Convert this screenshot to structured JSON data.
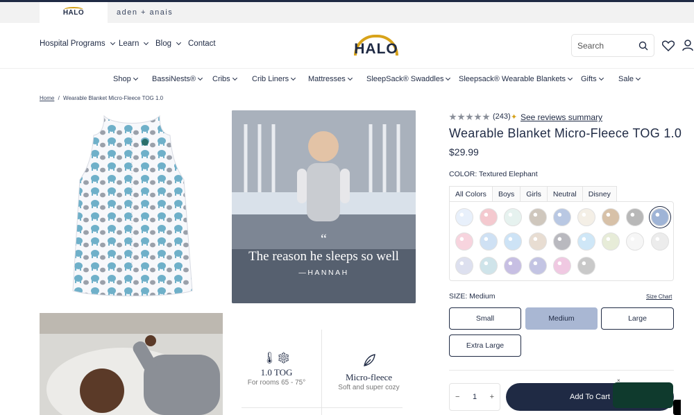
{
  "brand_bar": {
    "halo_tab": "HALO",
    "partner": "aden + anais"
  },
  "top_nav": {
    "items": [
      {
        "label": "Hospital Programs",
        "dropdown": true
      },
      {
        "label": "Learn",
        "dropdown": true
      },
      {
        "label": "Blog",
        "dropdown": true
      },
      {
        "label": "Contact",
        "dropdown": false
      }
    ]
  },
  "logo": {
    "text": "HALO"
  },
  "search": {
    "placeholder": "Search"
  },
  "main_nav": {
    "items": [
      {
        "label": "Shop"
      },
      {
        "label": "BassiNests®"
      },
      {
        "label": "Cribs"
      },
      {
        "label": "Crib Liners"
      },
      {
        "label": "Mattresses"
      },
      {
        "label": "SleepSack® Swaddles"
      },
      {
        "label": "Sleepsack® Wearable Blankets"
      },
      {
        "label": "Gifts"
      },
      {
        "label": "Sale"
      }
    ]
  },
  "breadcrumb": {
    "home": "Home",
    "separator": "/",
    "current": "Wearable Blanket Micro-Fleece TOG 1.0"
  },
  "gallery": {
    "quote_mark": "“",
    "quote": "The reason he sleeps so well",
    "quote_author": "—HANNAH",
    "features": [
      {
        "title": "1.0 TOG",
        "subtitle": "For rooms 65 - 75°",
        "icon": "thermometer-snowflake-icon"
      },
      {
        "title": "Micro-fleece",
        "subtitle": "Soft and super cozy",
        "icon": "leaf-icon"
      }
    ]
  },
  "product": {
    "rating": 5,
    "review_count": "(243)",
    "see_reviews": "See reviews summary",
    "title": "Wearable Blanket Micro-Fleece TOG 1.0",
    "price": "$29.99",
    "color_label": "COLOR: Textured Elephant",
    "color_tabs": [
      "All Colors",
      "Boys",
      "Girls",
      "Neutral",
      "Disney"
    ],
    "swatches": [
      "#e8f0fb",
      "#f4c9cf",
      "#e6f2ef",
      "#cfc7bd",
      "#b9c8e3",
      "#f4efe6",
      "#d7c1a8",
      "#b8b8b8",
      "#9fb4d6",
      "#f7d4de",
      "#cfe1f4",
      "#cde3f6",
      "#e8ddd2",
      "#b9b9bf",
      "#cfe7f7",
      "#e7ecd8",
      "#f6f6f6",
      "#ececec",
      "#dde0ef",
      "#cfe4ea",
      "#c7bfe3",
      "#c3c4e3",
      "#f0c9e2",
      "#c9c9c9"
    ],
    "size_label": "SIZE: Medium",
    "size_chart": "Size Chart",
    "sizes": [
      "Small",
      "Medium",
      "Large",
      "Extra Large"
    ],
    "selected_size": "Medium",
    "quantity": "1",
    "qty_minus": "−",
    "qty_plus": "+",
    "add_to_cart": "Add To Cart"
  },
  "chat_widget": {
    "close": "×"
  }
}
